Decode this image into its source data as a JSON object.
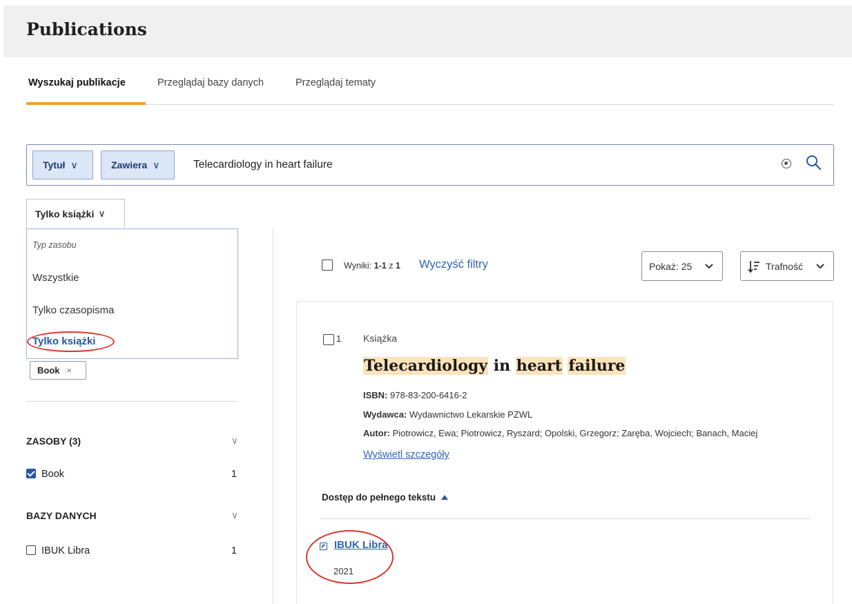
{
  "header": {
    "title": "Publications"
  },
  "tabs": [
    {
      "label": "Wyszukaj publikacje",
      "active": true
    },
    {
      "label": "Przeglądaj bazy danych",
      "active": false
    },
    {
      "label": "Przeglądaj tematy",
      "active": false
    }
  ],
  "search": {
    "field_label": "Tytuł",
    "operator_label": "Zawiera",
    "query": "Telecardiology in heart failure",
    "clear_icon": "circle-x-icon",
    "search_icon": "magnifier-icon"
  },
  "type_filter": {
    "selected_label": "Tylko książki",
    "group_label": "Typ zasobu",
    "options": [
      "Wszystkie",
      "Tylko czasopisma",
      "Tylko książki"
    ],
    "selected_index": 2
  },
  "active_chip": {
    "label": "Book",
    "remove": "×"
  },
  "facets": {
    "resources": {
      "title": "ZASOBY (3)",
      "items": [
        {
          "label": "Book",
          "count": "1",
          "checked": true
        }
      ]
    },
    "databases": {
      "title": "BAZY DANYCH",
      "items": [
        {
          "label": "IBUK Libra",
          "count": "1",
          "checked": false
        }
      ]
    }
  },
  "results": {
    "label_prefix": "Wyniki: ",
    "range": "1-1",
    "label_of": " z ",
    "total": "1",
    "clear_filters": "Wyczyść filtry",
    "show_label": "Pokaż: 25",
    "sort_label": "Trafność"
  },
  "result": {
    "number": "1",
    "type": "Książka",
    "title_parts": [
      {
        "text": "Telecardiology",
        "highlight": true
      },
      {
        "text": " in ",
        "highlight": false
      },
      {
        "text": "heart",
        "highlight": true
      },
      {
        "text": " ",
        "highlight": false
      },
      {
        "text": "failure",
        "highlight": true
      }
    ],
    "isbn_label": "ISBN:",
    "isbn": " 978-83-200-6416-2",
    "publisher_label": "Wydawca:",
    "publisher": " Wydawnictwo Lekarskie PZWL",
    "author_label": "Autor:",
    "authors": " Piotrowicz, Ewa; Piotrowicz, Ryszard; Opolski, Grzegorz; Zaręba, Wojciech; Banach, Maciej",
    "details_link": "Wyświetl szczegóły",
    "access_heading": "Dostęp do pełnego tekstu",
    "access_link": "IBUK Libra",
    "access_year": "2021"
  },
  "colors": {
    "accent_tab": "#f0a030",
    "link": "#2e64b8",
    "highlight": "#fbe3bb",
    "chip_bg": "#dbe6f6",
    "annotation": "#e0322b"
  }
}
